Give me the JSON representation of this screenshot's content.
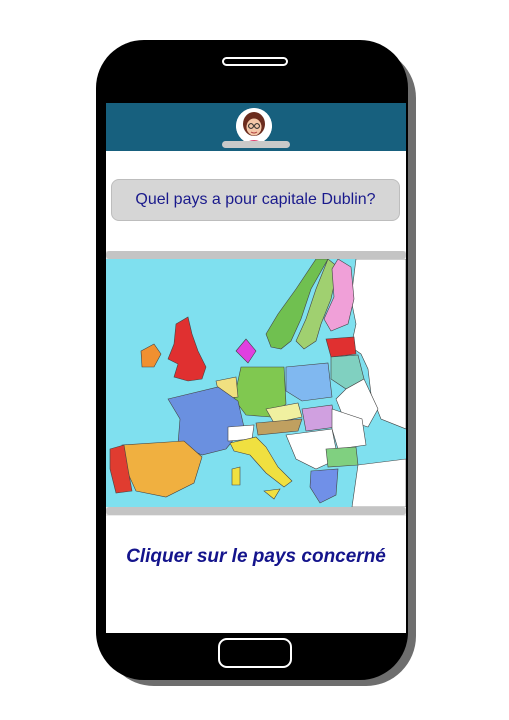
{
  "quiz": {
    "question": "Quel pays a pour capitale Dublin?",
    "instruction": "Cliquer sur le pays concerné"
  },
  "colors": {
    "phone_body": "#000000",
    "top_bar": "#17607e",
    "sea": "#7fe0ef",
    "question_text": "#1a1a8c",
    "instruction_text": "#14148c"
  },
  "map": {
    "countries": [
      {
        "name": "Ireland",
        "color": "#f09030"
      },
      {
        "name": "United Kingdom",
        "color": "#e03030"
      },
      {
        "name": "France",
        "color": "#6a90e0"
      },
      {
        "name": "Spain",
        "color": "#f0b040"
      },
      {
        "name": "Portugal",
        "color": "#e03c30"
      },
      {
        "name": "Germany",
        "color": "#80c850"
      },
      {
        "name": "Italy",
        "color": "#f0e040"
      },
      {
        "name": "Poland",
        "color": "#80b8f0"
      },
      {
        "name": "Norway",
        "color": "#70c050"
      },
      {
        "name": "Sweden",
        "color": "#a0d070"
      },
      {
        "name": "Finland",
        "color": "#f0a0d8"
      }
    ]
  }
}
